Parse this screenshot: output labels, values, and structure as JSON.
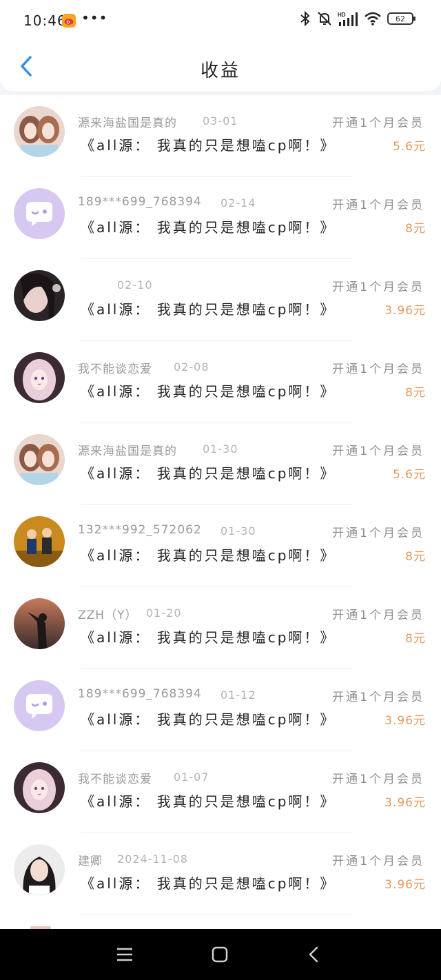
{
  "status": {
    "time": "10:46",
    "more": "•••",
    "battery": "62",
    "icons": [
      "weibo-icon",
      "bluetooth-icon",
      "bell-muted-icon",
      "hd-signal-icon",
      "wifi-icon",
      "battery-icon"
    ]
  },
  "header": {
    "title": "收益",
    "back_icon": "chevron-left-icon"
  },
  "colors": {
    "amount": "#e8995c",
    "accent": "#2f8ff0",
    "meta": "#9a9a9a",
    "text": "#222222"
  },
  "records": [
    {
      "user": "源来海盐国是真的",
      "date": "03-01",
      "item": "开通1个月会员",
      "title": "《all源： 我真的只是想嗑cp啊！》",
      "amount": "5.6元",
      "avatar": "twin-girls"
    },
    {
      "user": "189***699_768394…",
      "date": "02-14",
      "item": "开通1个月会员",
      "title": "《all源： 我真的只是想嗑cp啊！》",
      "amount": "8元",
      "avatar": "default-chat"
    },
    {
      "user": "",
      "date": "02-10",
      "item": "开通1个月会员",
      "title": "《all源： 我真的只是想嗑cp啊！》",
      "amount": "3.96元",
      "avatar": "dark-selfie"
    },
    {
      "user": "我不能谈恋爱",
      "date": "02-08",
      "item": "开通1个月会员",
      "title": "《all源： 我真的只是想嗑cp啊！》",
      "amount": "8元",
      "avatar": "anime-girl"
    },
    {
      "user": "源来海盐国是真的",
      "date": "01-30",
      "item": "开通1个月会员",
      "title": "《all源： 我真的只是想嗑cp啊！》",
      "amount": "5.6元",
      "avatar": "twin-girls"
    },
    {
      "user": "132***992_572062…",
      "date": "01-30",
      "item": "开通1个月会员",
      "title": "《all源： 我真的只是想嗑cp啊！》",
      "amount": "8元",
      "avatar": "two-kids"
    },
    {
      "user": "ZZH（Y）",
      "date": "01-20",
      "item": "开通1个月会员",
      "title": "《all源： 我真的只是想嗑cp啊！》",
      "amount": "8元",
      "avatar": "sunset-girl"
    },
    {
      "user": "189***699_768394…",
      "date": "01-12",
      "item": "开通1个月会员",
      "title": "《all源： 我真的只是想嗑cp啊！》",
      "amount": "3.96元",
      "avatar": "default-chat"
    },
    {
      "user": "我不能谈恋爱",
      "date": "01-07",
      "item": "开通1个月会员",
      "title": "《all源： 我真的只是想嗑cp啊！》",
      "amount": "3.96元",
      "avatar": "anime-girl"
    },
    {
      "user": "建卿",
      "date": "2024-11-08",
      "item": "开通1个月会员",
      "title": "《all源： 我真的只是想嗑cp啊！》",
      "amount": "3.96元",
      "avatar": "portrait-girl"
    }
  ],
  "system_nav": [
    "menu-icon",
    "home-square-icon",
    "back-arrow-icon"
  ]
}
